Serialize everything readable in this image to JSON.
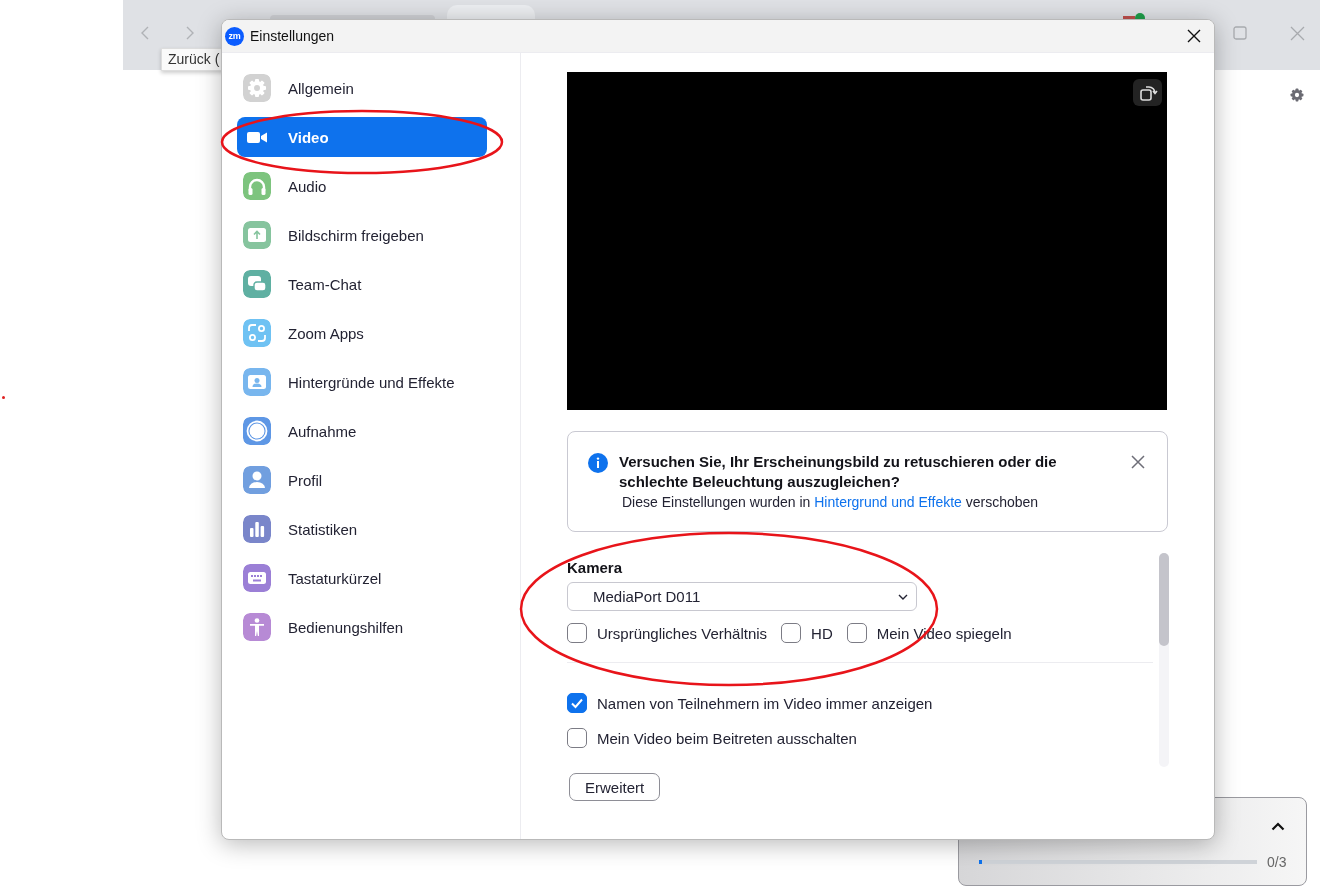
{
  "browser": {
    "tooltip": "Zurück (",
    "widget": {
      "counter": "0/3",
      "level": 0.01
    }
  },
  "window": {
    "logo": "zm",
    "title": "Einstellungen"
  },
  "sidebar": {
    "items": [
      {
        "label": "Allgemein",
        "kind": "gear",
        "color": "#d2d2d2",
        "selected": false
      },
      {
        "label": "Video",
        "kind": "video",
        "color": "#ffffff",
        "selected": true
      },
      {
        "label": "Audio",
        "kind": "headphones",
        "color": "#7dc47e",
        "selected": false
      },
      {
        "label": "Bildschirm freigeben",
        "kind": "share",
        "color": "#86c49e",
        "selected": false
      },
      {
        "label": "Team-Chat",
        "kind": "chat",
        "color": "#5fb0a2",
        "selected": false
      },
      {
        "label": "Zoom Apps",
        "kind": "apps",
        "color": "#6fc2f3",
        "selected": false
      },
      {
        "label": "Hintergründe und Effekte",
        "kind": "background",
        "color": "#78b6ee",
        "selected": false
      },
      {
        "label": "Aufnahme",
        "kind": "record",
        "color": "#5e97e5",
        "selected": false
      },
      {
        "label": "Profil",
        "kind": "profile",
        "color": "#719fdf",
        "selected": false
      },
      {
        "label": "Statistiken",
        "kind": "stats",
        "color": "#7a86ca",
        "selected": false
      },
      {
        "label": "Tastaturkürzel",
        "kind": "keyboard",
        "color": "#9b7fd6",
        "selected": false
      },
      {
        "label": "Bedienungshilfen",
        "kind": "accessibility",
        "color": "#b78ad5",
        "selected": false
      }
    ]
  },
  "notice": {
    "title": "Versuchen Sie, Ihr Erscheinungsbild zu retuschieren oder die schlechte Beleuchtung auszugleichen?",
    "text_before": "Diese Einstellungen wurden in",
    "link": "Hintergrund und Effekte",
    "text_after": "verschoben"
  },
  "camera": {
    "label": "Kamera",
    "value": "MediaPort D011",
    "options": [
      {
        "label": "Ursprüngliches Verhältnis",
        "checked": false
      },
      {
        "label": "HD",
        "checked": false
      },
      {
        "label": "Mein Video spiegeln",
        "checked": false
      }
    ]
  },
  "options": [
    {
      "label": "Namen von Teilnehmern im Video immer anzeigen",
      "checked": true
    },
    {
      "label": "Mein Video beim Beitreten ausschalten",
      "checked": false
    }
  ],
  "advanced_button": "Erweitert"
}
